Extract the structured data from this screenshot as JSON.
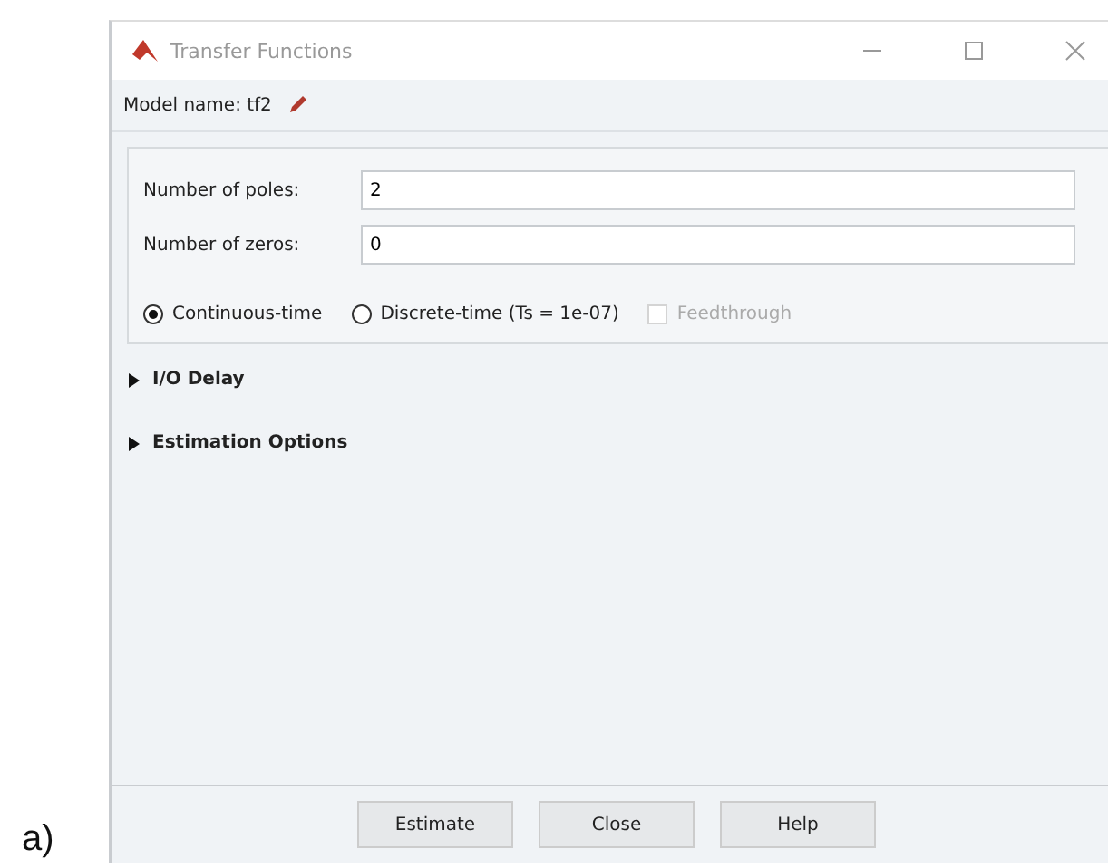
{
  "caption": "a)",
  "window": {
    "title": "Transfer Functions"
  },
  "model_name": "Model name: tf2",
  "fields": [
    {
      "label": "Number of poles:",
      "value": "2"
    },
    {
      "label": "Number of zeros:",
      "value": "0"
    }
  ],
  "time_domain": [
    {
      "label": "Continuous-time",
      "selected": true
    },
    {
      "label": "Discrete-time (Ts = 1e-07)",
      "selected": false
    }
  ],
  "feedthrough": {
    "label": "Feedthrough",
    "checked": false,
    "disabled": true
  },
  "sections": [
    {
      "label": "I/O Delay",
      "expanded": false
    },
    {
      "label": "Estimation Options",
      "expanded": false
    }
  ],
  "buttons": [
    "Estimate",
    "Close",
    "Help"
  ]
}
